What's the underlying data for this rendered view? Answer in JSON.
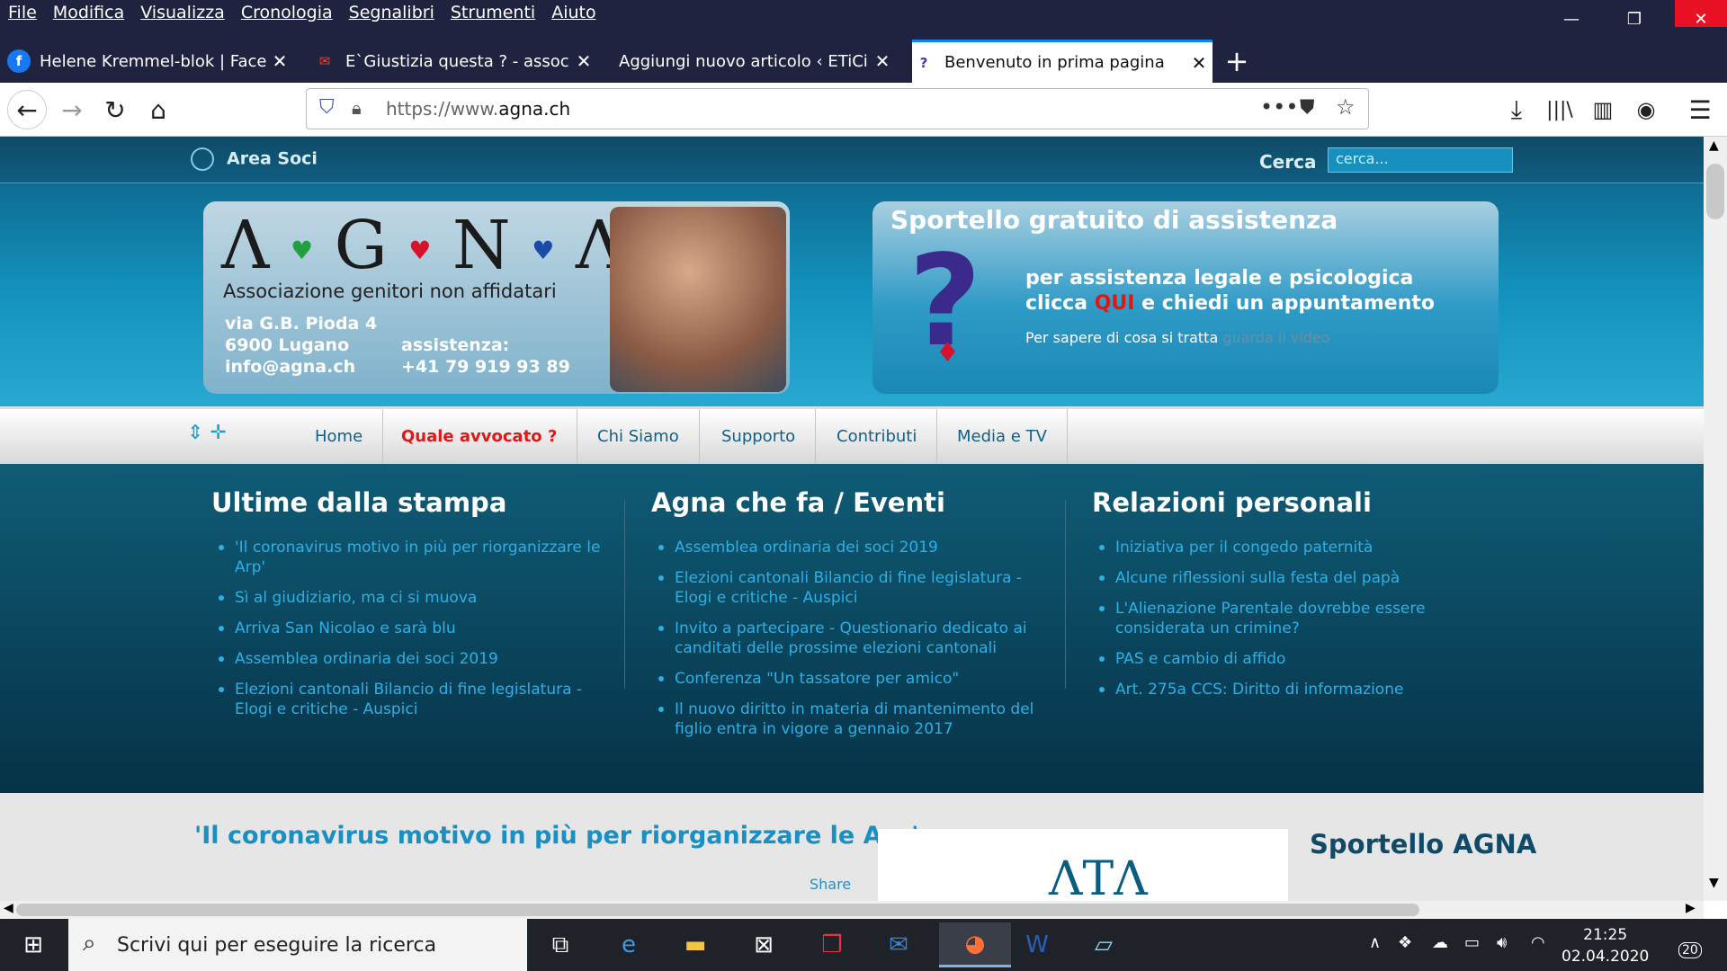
{
  "menu": [
    "File",
    "Modifica",
    "Visualizza",
    "Cronologia",
    "Segnalibri",
    "Strumenti",
    "Aiuto"
  ],
  "window": {
    "minimize_icon": "minimize-icon",
    "restore_icon": "restore-icon",
    "close_icon": "close-icon",
    "close_color": "#e81123"
  },
  "tabs": [
    {
      "title": "Helene Kremmel-blok | Facebook",
      "icon": "facebook-icon"
    },
    {
      "title": "E`Giustizia questa ? - associazio",
      "icon": "gmail-icon"
    },
    {
      "title": "Aggiungi nuovo articolo ‹ ETiCinfor",
      "icon": ""
    },
    {
      "title": "Benvenuto in prima pagina",
      "icon": "question-icon"
    }
  ],
  "url": {
    "prefix": "https://www.",
    "domain": "agna.ch"
  },
  "site": {
    "area_soci": "Area Soci",
    "cerca_label": "Cerca",
    "search_placeholder": "cerca...",
    "logo_letters": [
      "Λ",
      "G",
      "N",
      "Λ"
    ],
    "logo_subtitle": "Associazione genitori non affidatari",
    "address": [
      "via G.B. Pioda 4",
      "6900 Lugano",
      "info@agna.ch"
    ],
    "assistance": [
      "assistenza:",
      "+41 79 919 93 89"
    ],
    "sportello_title": "Sportello gratuito di assistenza",
    "sportello_line1": "per assistenza legale e psicologica",
    "sportello_line2_pre": "clicca",
    "sportello_qui": "QUI",
    "sportello_line2_post": "e chiedi un appuntamento",
    "sportello_line3": "Per sapere di cosa si tratta",
    "sportello_video": "guarda il video",
    "qmark": "?",
    "nav": [
      "Home",
      "Quale avvocato ?",
      "Chi Siamo",
      "Supporto",
      "Contributi",
      "Media e TV"
    ],
    "columns": [
      {
        "title": "Ultime dalla stampa",
        "items": [
          "'Il coronavirus motivo in più per riorganizzare le Arp'",
          "Sì al giudiziario, ma ci si muova",
          "Arriva San Nicolao e sarà blu",
          "Assemblea ordinaria dei soci 2019",
          "Elezioni cantonali Bilancio di fine legislatura - Elogi e critiche - Auspici"
        ]
      },
      {
        "title": "Agna che fa / Eventi",
        "items": [
          "Assemblea ordinaria dei soci 2019",
          "Elezioni cantonali Bilancio di fine legislatura - Elogi e critiche - Auspici",
          "Invito a partecipare - Questionario dedicato ai canditati delle prossime elezioni cantonali",
          "Conferenza \"Un tassatore per amico\"",
          "Il nuovo diritto in materia di mantenimento del figlio entra in vigore a gennaio 2017"
        ]
      },
      {
        "title": "Relazioni personali",
        "items": [
          "Iniziativa per il congedo paternità",
          "Alcune riflessioni sulla festa del papà",
          "L'Alienazione Parentale dovrebbe essere considerata un crimine?",
          "PAS e cambio di affido",
          "Art. 275a CCS: Diritto di informazione"
        ]
      }
    ],
    "article_title": "'Il coronavirus motivo in più per riorganizzare le Arp'",
    "share": "Share",
    "sportello_agna": "Sportello AGNA"
  },
  "taskbar": {
    "search_placeholder": "Scrivi qui per eseguire la ricerca",
    "time": "21:25",
    "date": "02.04.2020",
    "notifications": "20"
  }
}
